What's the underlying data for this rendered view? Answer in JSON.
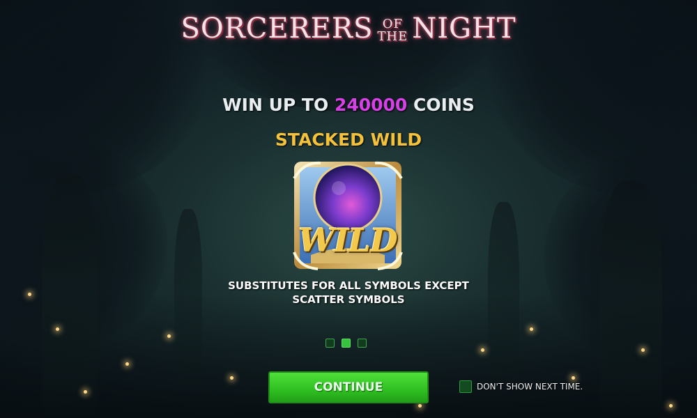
{
  "game": {
    "logo_main_1": "SORCERERS",
    "logo_small_top": "OF",
    "logo_small_bottom": "THE",
    "logo_main_2": "NIGHT"
  },
  "promo": {
    "win_prefix": "WIN UP TO",
    "win_amount": "240000",
    "win_suffix": "COINS"
  },
  "feature": {
    "title": "STACKED WILD",
    "symbol_label": "WILD",
    "description_line1": "SUBSTITUTES FOR ALL SYMBOLS EXCEPT",
    "description_line2": "SCATTER SYMBOLS"
  },
  "pager": {
    "total_pages": 3,
    "active_page": 2
  },
  "buttons": {
    "continue_label": "CONTINUE",
    "dont_show_label": "DON'T SHOW NEXT TIME."
  },
  "colors": {
    "accent_green": "#36c23e",
    "win_amount": "#d640e6",
    "feature_title": "#f3c23a"
  }
}
